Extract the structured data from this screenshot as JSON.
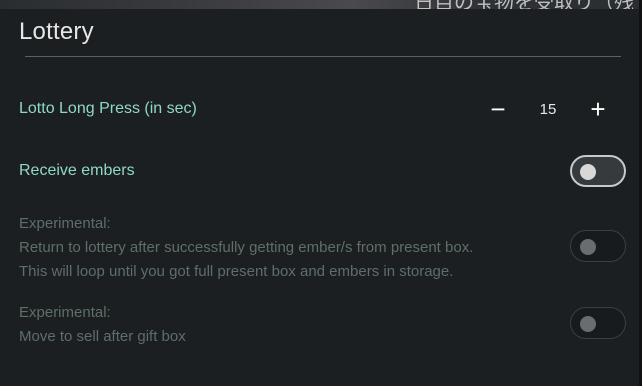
{
  "header": {
    "background_text": "日目の宝物を受取り（残",
    "section_title": "Lottery"
  },
  "settings": {
    "lotto_long_press": {
      "label": "Lotto Long Press (in sec)",
      "value": "15",
      "decrement_symbol": "−",
      "increment_symbol": "+"
    },
    "receive_embers": {
      "label": "Receive embers",
      "enabled": false
    },
    "return_to_lottery": {
      "line1": "Experimental:",
      "line2": "Return to lottery after successfully getting ember/s from present box.",
      "line3": "This will loop until you got full present box and embers in storage.",
      "enabled": false,
      "disabled_state": true
    },
    "move_to_sell": {
      "line1": "Experimental:",
      "line2": "Move to sell after gift box",
      "enabled": false,
      "disabled_state": true
    }
  },
  "colors": {
    "background": "#1c1f21",
    "accent_label": "#8fd9c3",
    "dim_text": "#5e6e68",
    "title": "#e6e6e6"
  }
}
